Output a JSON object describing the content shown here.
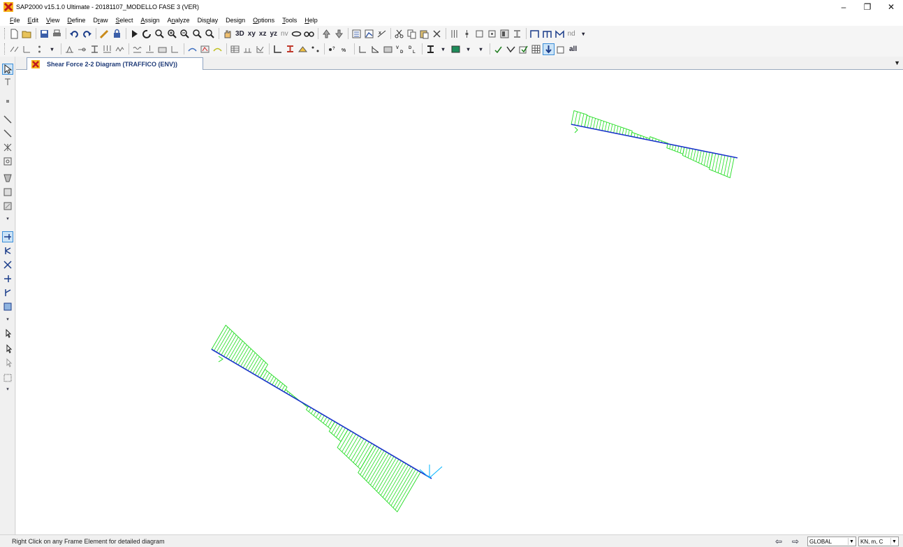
{
  "window": {
    "title": "SAP2000 v15.1.0 Ultimate  - 20181107_MODELLO FASE 3 (VER)",
    "minimize": "–",
    "restore": "❐",
    "close": "✕"
  },
  "menu": [
    {
      "pre": "",
      "ul": "F",
      "post": "ile"
    },
    {
      "pre": "",
      "ul": "E",
      "post": "dit"
    },
    {
      "pre": "",
      "ul": "V",
      "post": "iew"
    },
    {
      "pre": "",
      "ul": "D",
      "post": "efine"
    },
    {
      "pre": "D",
      "ul": "r",
      "post": "aw"
    },
    {
      "pre": "",
      "ul": "S",
      "post": "elect"
    },
    {
      "pre": "",
      "ul": "A",
      "post": "ssign"
    },
    {
      "pre": "A",
      "ul": "n",
      "post": "alyze"
    },
    {
      "pre": "Dis",
      "ul": "p",
      "post": "lay"
    },
    {
      "pre": "Desi",
      "ul": "g",
      "post": "n"
    },
    {
      "pre": "",
      "ul": "O",
      "post": "ptions"
    },
    {
      "pre": "",
      "ul": "T",
      "post": "ools"
    },
    {
      "pre": "",
      "ul": "H",
      "post": "elp"
    }
  ],
  "toolbar": {
    "view_xy": "xy",
    "view_xz": "xz",
    "view_yz": "yz",
    "view_nv": "nv",
    "view_3d": "3D",
    "nd": "nd",
    "all": "all"
  },
  "tab": {
    "label": "Shear Force 2-2 Diagram  (TRAFFICO (ENV))",
    "dropdown": "▼"
  },
  "diagram": {
    "diagram_color": "#22dd22",
    "frame_color": "#1a33cc",
    "axis_color": "#00b4ff"
  },
  "status": {
    "hint": "Right Click on any Frame Element for detailed diagram",
    "coord_system": "GLOBAL",
    "units": "KN, m, C"
  }
}
